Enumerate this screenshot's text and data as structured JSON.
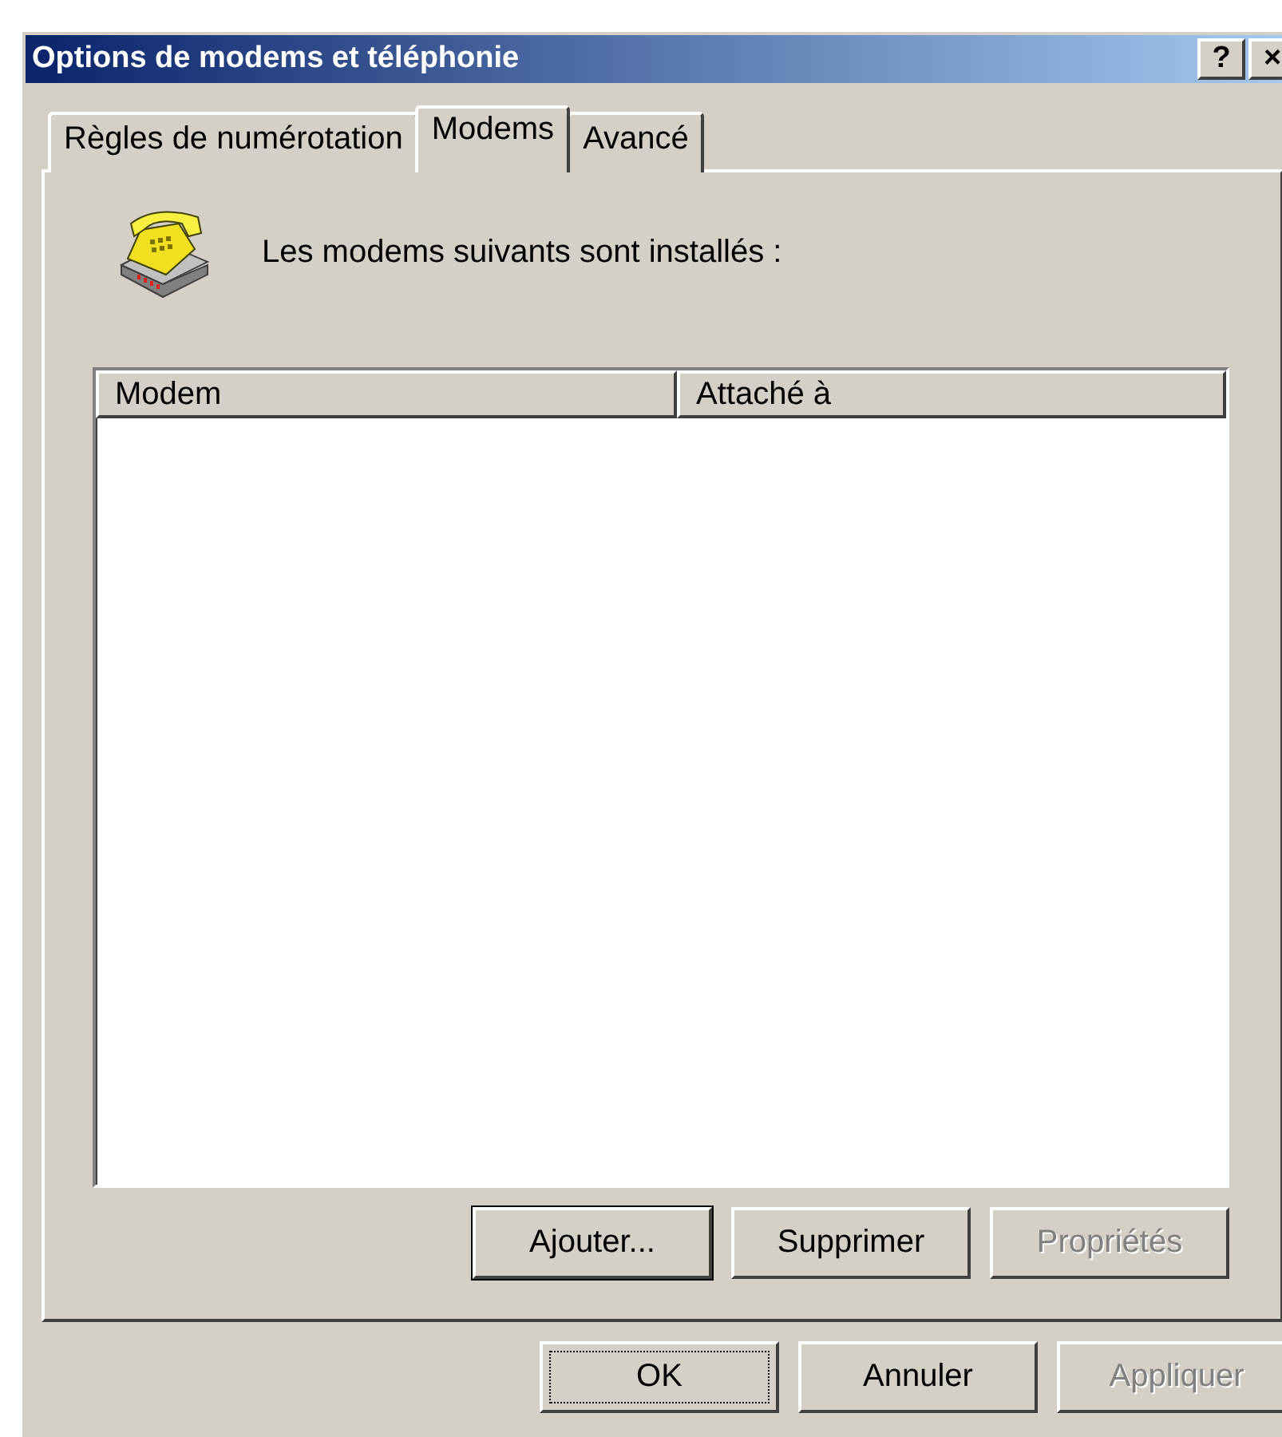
{
  "window": {
    "title": "Options de modems et téléphonie",
    "title_buttons": [
      "?",
      "×"
    ]
  },
  "tabs": [
    {
      "label": "Règles de numérotation",
      "selected": false
    },
    {
      "label": "Modems",
      "selected": true
    },
    {
      "label": "Avancé",
      "selected": false
    }
  ],
  "intro": "Les modems suivants sont installés :",
  "table": {
    "columns": [
      "Modem",
      "Attaché à"
    ]
  },
  "panel_buttons": [
    {
      "label": "Ajouter...",
      "disabled": false,
      "default": true,
      "focused": false
    },
    {
      "label": "Supprimer",
      "disabled": false,
      "default": false,
      "focused": false
    },
    {
      "label": "Propriétés",
      "disabled": true,
      "default": false,
      "focused": false
    }
  ],
  "dialog_buttons": [
    {
      "label": "OK",
      "disabled": false,
      "default": false,
      "focused": true
    },
    {
      "label": "Annuler",
      "disabled": false,
      "default": false,
      "focused": false
    },
    {
      "label": "Appliquer",
      "disabled": true,
      "default": false,
      "focused": false
    }
  ]
}
